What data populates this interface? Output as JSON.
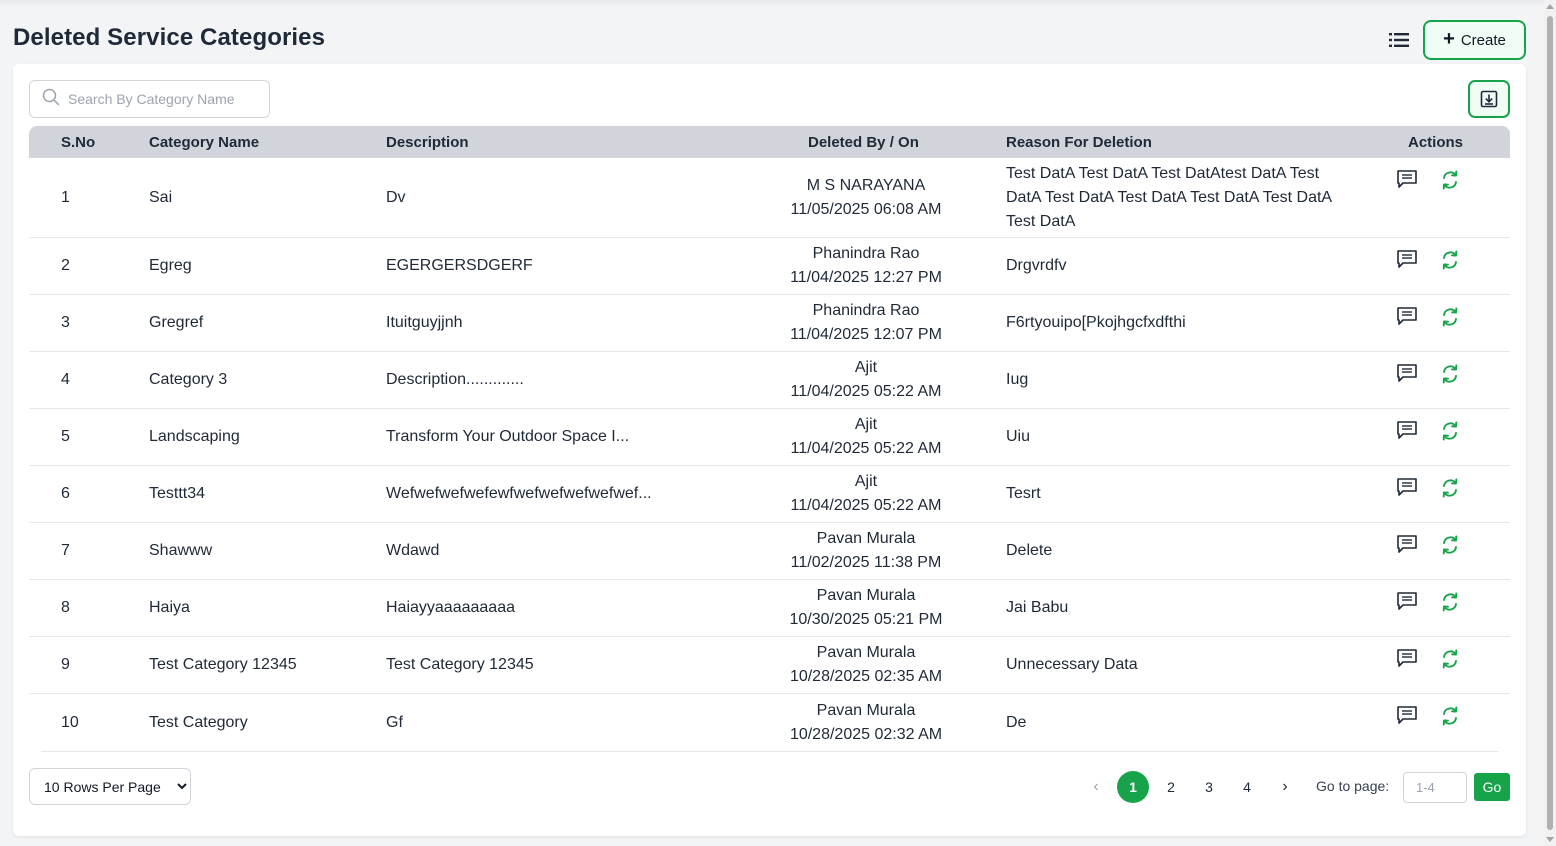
{
  "page": {
    "title": "Deleted Service Categories"
  },
  "toolbar": {
    "list_icon": "list-icon",
    "create_label": "Create"
  },
  "search": {
    "placeholder": "Search By Category Name"
  },
  "table": {
    "headers": {
      "sno": "S.No",
      "name": "Category Name",
      "description": "Description",
      "deleted": "Deleted By / On",
      "reason": "Reason For Deletion",
      "actions": "Actions"
    },
    "rows": [
      {
        "sno": "1",
        "name": "Sai",
        "description": "Dv",
        "deleted_by": "M S NARAYANA",
        "deleted_on": "11/05/2025 06:08 AM",
        "reason": "Test DatA Test DatA Test DatAtest DatA Test DatA Test DatA Test DatA Test DatA Test DatA Test DatA"
      },
      {
        "sno": "2",
        "name": "Egreg",
        "description": "EGERGERSDGERF",
        "deleted_by": "Phanindra Rao",
        "deleted_on": "11/04/2025 12:27 PM",
        "reason": "Drgvrdfv"
      },
      {
        "sno": "3",
        "name": "Gregref",
        "description": "Ituitguyjjnh",
        "deleted_by": "Phanindra Rao",
        "deleted_on": "11/04/2025 12:07 PM",
        "reason": "F6rtyouipo[Pkojhgcfxdfthi"
      },
      {
        "sno": "4",
        "name": "Category 3",
        "description": "Description.............",
        "deleted_by": "Ajit",
        "deleted_on": "11/04/2025 05:22 AM",
        "reason": "Iug"
      },
      {
        "sno": "5",
        "name": "Landscaping",
        "description": "Transform Your Outdoor Space I...",
        "deleted_by": "Ajit",
        "deleted_on": "11/04/2025 05:22 AM",
        "reason": "Uiu"
      },
      {
        "sno": "6",
        "name": "Testtt34",
        "description": "Wefwefwefwefewfwefwefwefwefwef...",
        "deleted_by": "Ajit",
        "deleted_on": "11/04/2025 05:22 AM",
        "reason": "Tesrt"
      },
      {
        "sno": "7",
        "name": "Shawww",
        "description": "Wdawd",
        "deleted_by": "Pavan Murala",
        "deleted_on": "11/02/2025 11:38 PM",
        "reason": "Delete"
      },
      {
        "sno": "8",
        "name": "Haiya",
        "description": "Haiayyaaaaaaaaa",
        "deleted_by": "Pavan Murala",
        "deleted_on": "10/30/2025 05:21 PM",
        "reason": "Jai Babu"
      },
      {
        "sno": "9",
        "name": "Test Category 12345",
        "description": "Test Category 12345",
        "deleted_by": "Pavan Murala",
        "deleted_on": "10/28/2025 02:35 AM",
        "reason": "Unnecessary Data"
      },
      {
        "sno": "10",
        "name": "Test Category",
        "description": "Gf",
        "deleted_by": "Pavan Murala",
        "deleted_on": "10/28/2025 02:32 AM",
        "reason": "De"
      }
    ],
    "action_icons": [
      "message-icon",
      "restore-icon"
    ]
  },
  "footer": {
    "rows_per_page": "10 Rows Per Page",
    "pages": [
      "1",
      "2",
      "3",
      "4"
    ],
    "current_page": "1",
    "goto_label": "Go to page:",
    "goto_placeholder": "1-4",
    "go_label": "Go"
  },
  "colors": {
    "accent": "#16a34a",
    "header_bg": "#d1d5db",
    "text": "#1f2937"
  }
}
